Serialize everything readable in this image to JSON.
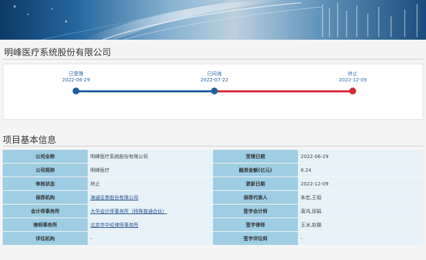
{
  "company_name": "明峰医疗系统股份有限公司",
  "timeline": [
    {
      "status": "已受理",
      "date": "2022-06-29",
      "color": "#1f5fa0"
    },
    {
      "status": "已问询",
      "date": "2022-07-22",
      "color": "#1f5fa0"
    },
    {
      "status": "终止",
      "date": "2022-12-09",
      "color": "#d42a36"
    }
  ],
  "section_title": "项目基本信息",
  "info_rows": [
    {
      "k1": "公司全称",
      "v1": "明峰医疗系统股份有限公司",
      "k2": "受理日期",
      "v2": "2022-06-29"
    },
    {
      "k1": "公司简称",
      "v1": "明峰医疗",
      "k2": "融资金额(亿元)",
      "v2": "6.24"
    },
    {
      "k1": "审核状态",
      "v1": "终止",
      "k2": "更新日期",
      "v2": "2022-12-09"
    },
    {
      "k1": "保荐机构",
      "v1": "海通证券股份有限公司",
      "k2": "保荐代表人",
      "v2": "朱宏,王韬"
    },
    {
      "k1": "会计师事务所",
      "v1": "大华会计师事务所（特殊普通合伙）",
      "k2": "签字会计师",
      "v2": "唐鸿,邱娟"
    },
    {
      "k1": "律师事务所",
      "v1": "北京市中伦律师事务所",
      "k2": "签字律师",
      "v2": "王冰,赵娜"
    },
    {
      "k1": "评估机构",
      "v1": "-",
      "k2": "签字评估师",
      "v2": "-"
    }
  ]
}
